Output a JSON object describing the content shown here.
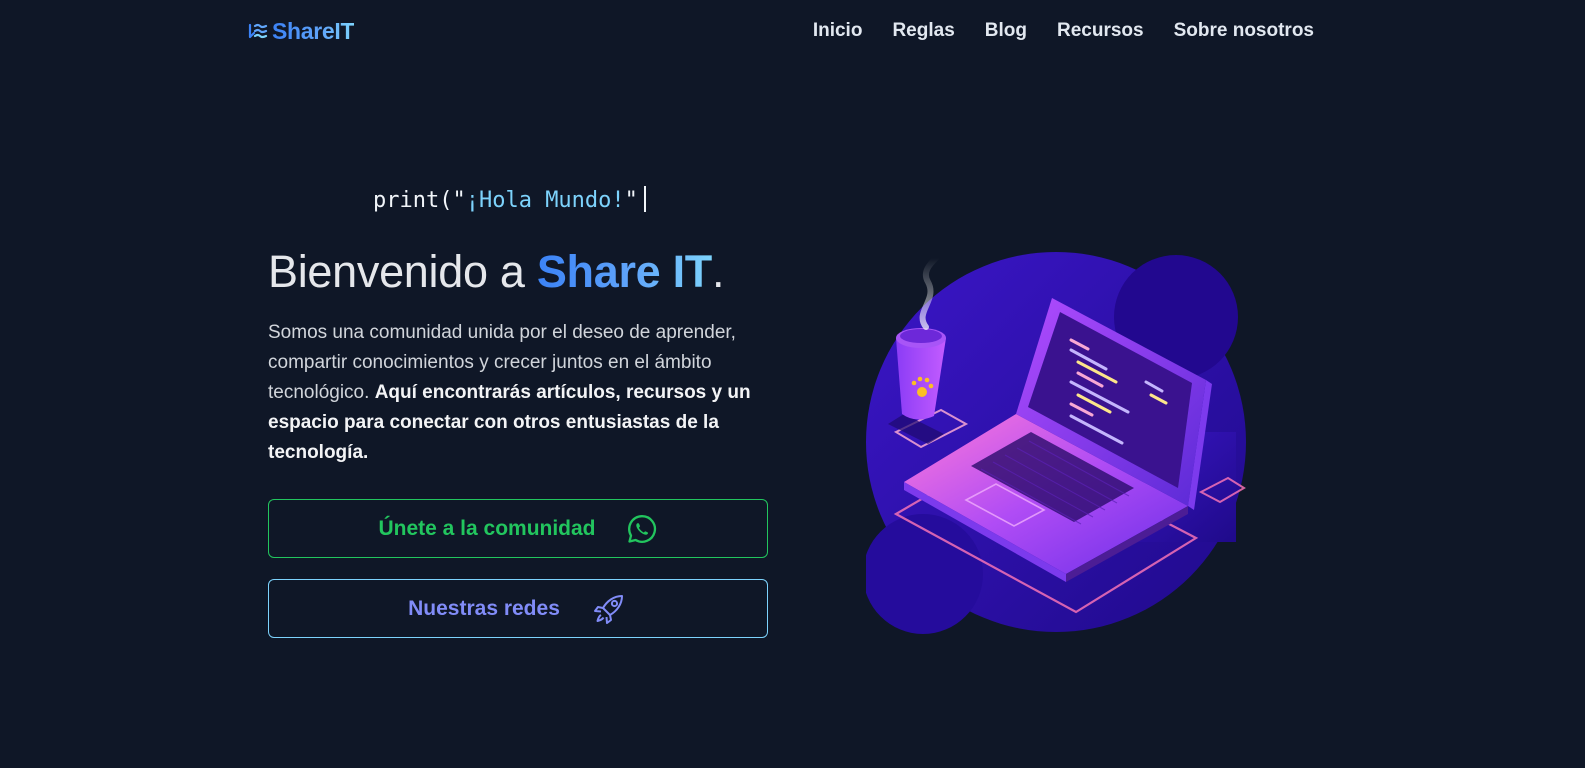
{
  "header": {
    "logo_text": "ShareIT",
    "nav": [
      {
        "label": "Inicio"
      },
      {
        "label": "Reglas"
      },
      {
        "label": "Blog"
      },
      {
        "label": "Recursos"
      },
      {
        "label": "Sobre nosotros"
      }
    ]
  },
  "hero": {
    "code_prefix": "print(\"",
    "code_string": "¡Hola Mundo!",
    "code_suffix": "\"",
    "title_prefix": "Bienvenido a ",
    "title_brand": "Share IT",
    "title_suffix": ".",
    "description_plain": "Somos una comunidad unida por el deseo de aprender, compartir conocimientos y crecer juntos en el ámbito tecnológico. ",
    "description_bold": "Aquí encontrarás artículos, recursos y un espacio para conectar con otros entusiastas de la tecnología.",
    "community_button_label": "Únete a la comunidad",
    "social_button_label": "Nuestras redes"
  },
  "icons": {
    "logo": "waves-logo-icon",
    "community_button": "whatsapp-icon",
    "social_button": "rocket-icon",
    "illustration": "laptop-coffee-illustration"
  },
  "colors": {
    "background": "#0f1727",
    "brand_gradient_start": "#3b82f6",
    "brand_gradient_end": "#7dd3fc",
    "community_green": "#22c55e",
    "social_indigo": "#818cf8",
    "code_string": "#7dd3fc"
  }
}
